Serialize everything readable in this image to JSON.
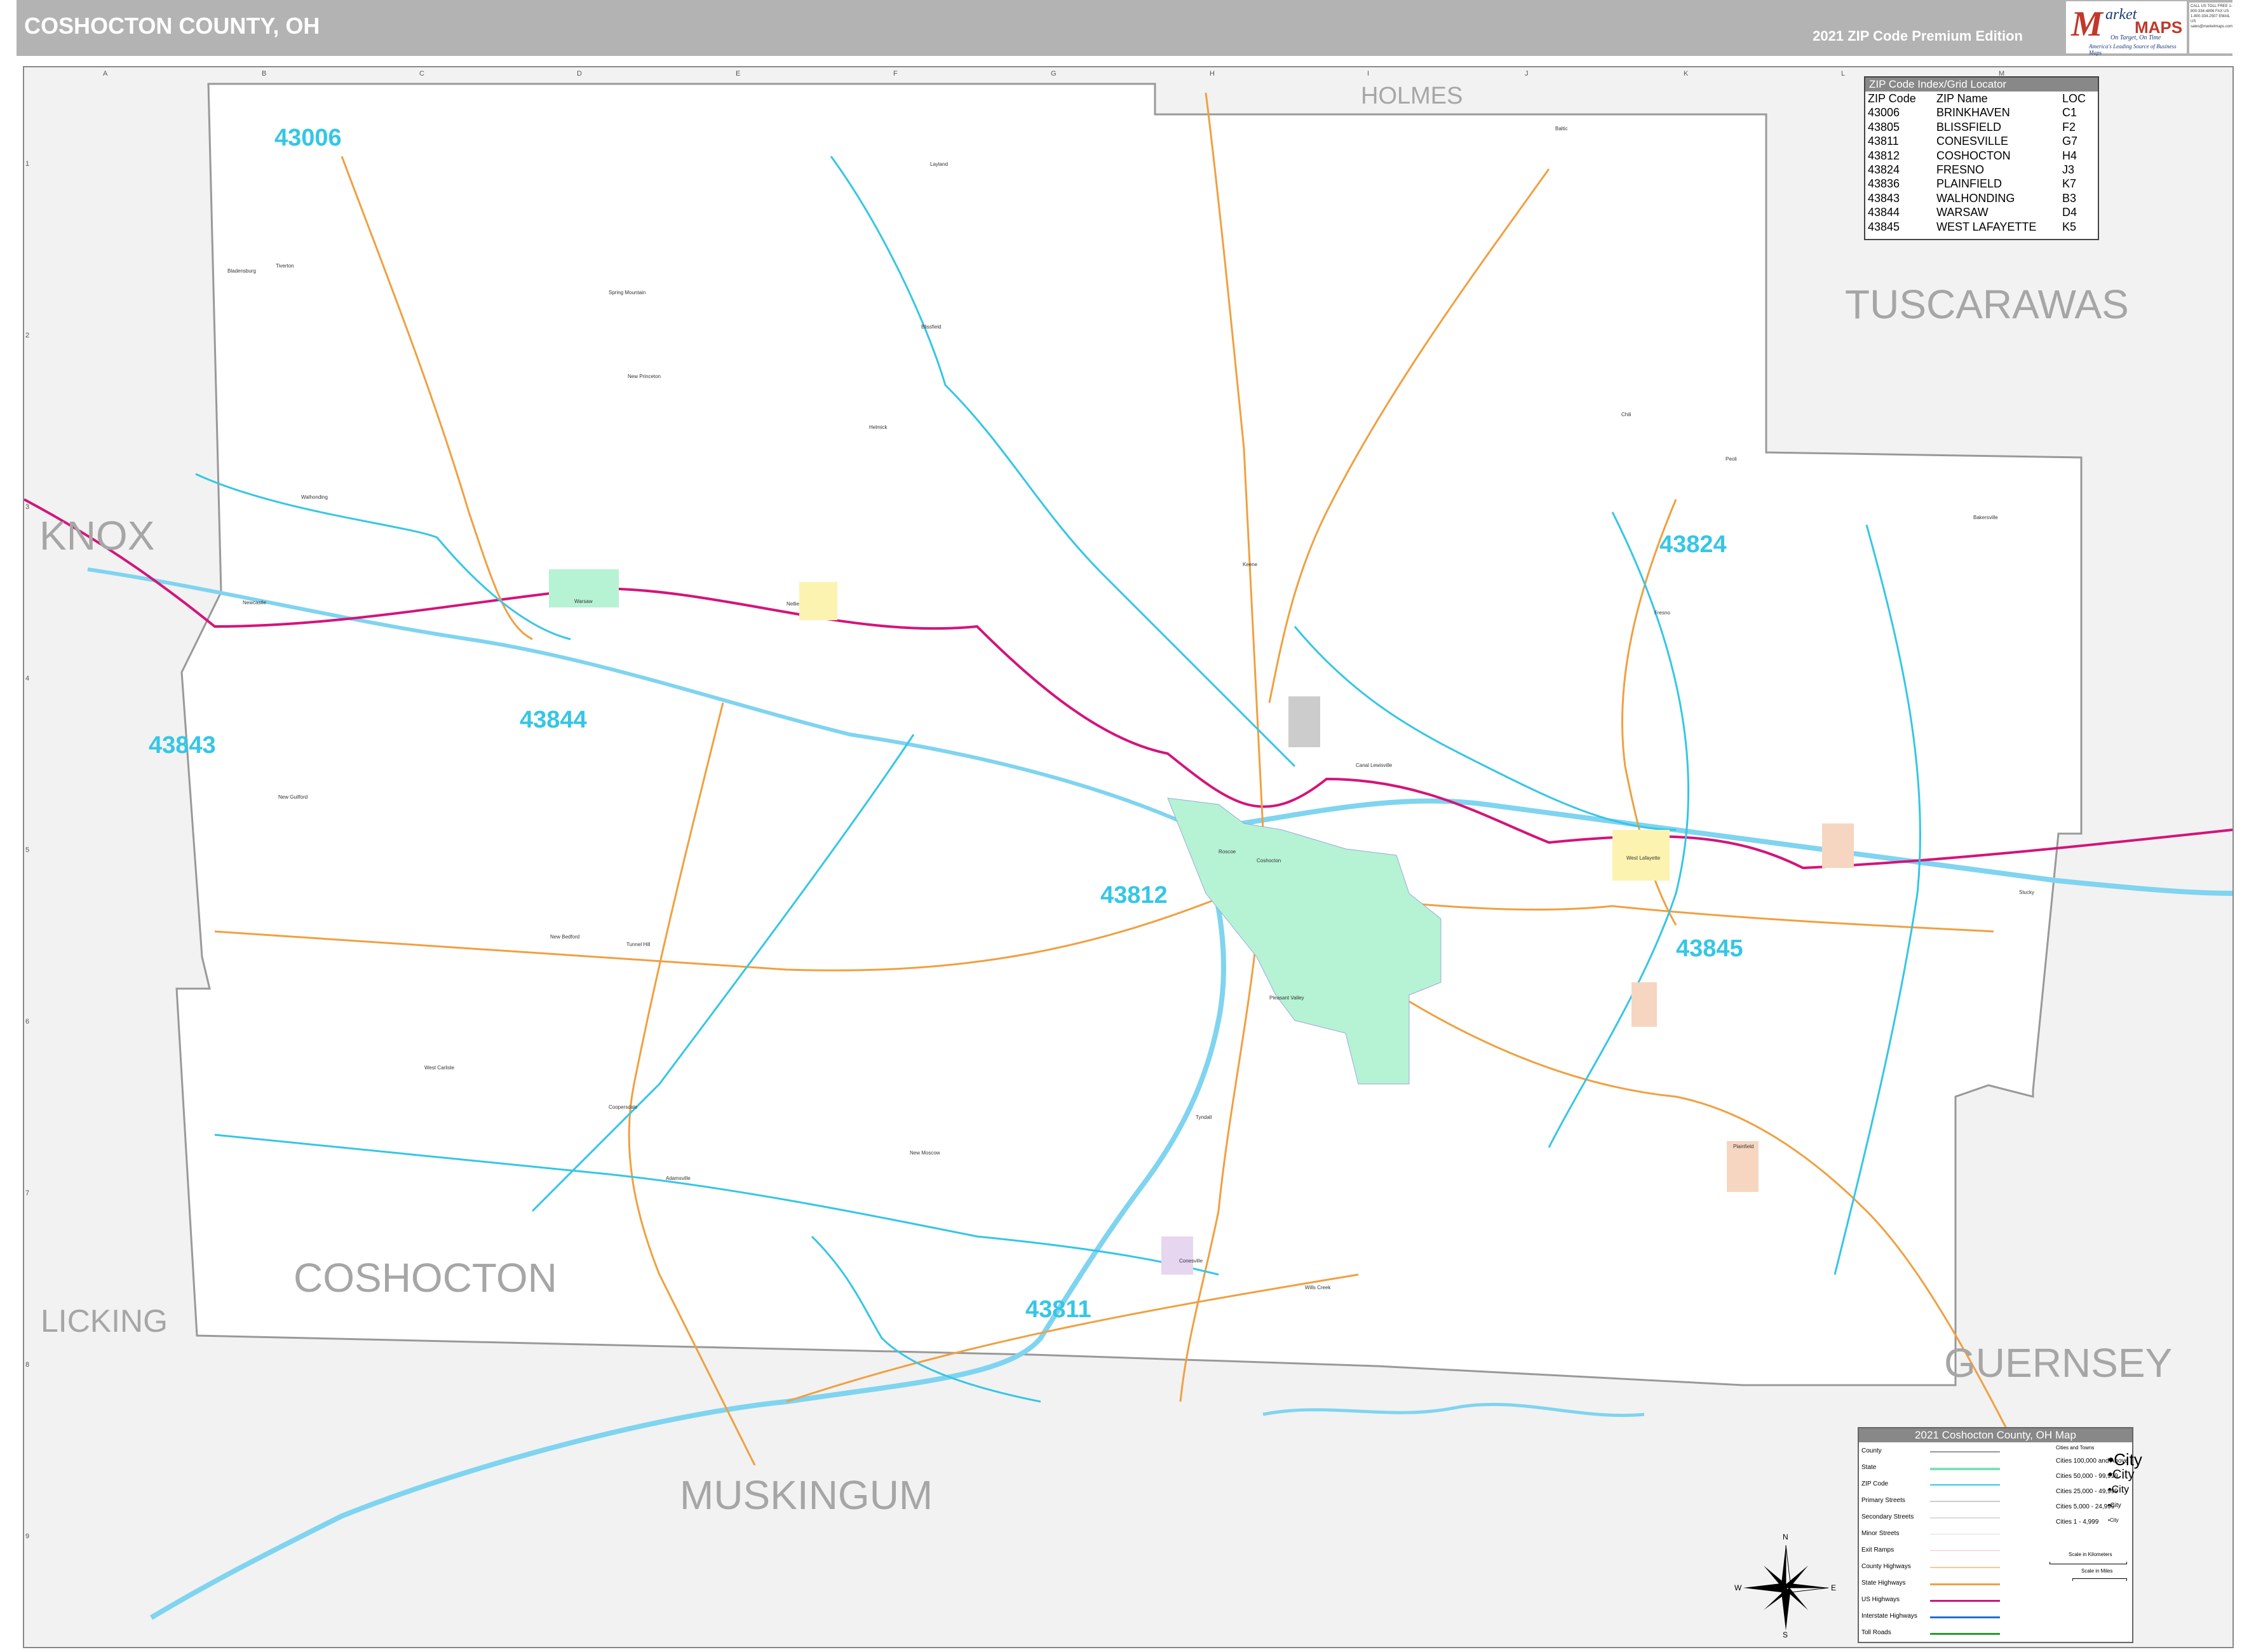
{
  "header": {
    "title": "COSHOCTON COUNTY, OH",
    "edition": "2021 ZIP Code Premium Edition"
  },
  "logo": {
    "m": "M",
    "arket": "arket",
    "maps": "MAPS",
    "tagline1": "On Target, On Time",
    "tagline2": "America's Leading Source of Business Maps",
    "contact": "CALL US TOLL FREE 1-800-334-4806 FAX US 1-800-334-2507 EMAIL US sales@marketmaps.com"
  },
  "counties": {
    "holmes": "HOLMES",
    "tuscarawas": "TUSCARAWAS",
    "knox": "KNOX",
    "coshocton": "COSHOCTON",
    "licking": "LICKING",
    "guernsey": "GUERNSEY",
    "muskingum": "MUSKINGUM"
  },
  "zip_labels": [
    "43006",
    "43824",
    "43843",
    "43844",
    "43812",
    "43845",
    "43811"
  ],
  "places": {
    "walhonding": "Walhonding",
    "newcastle": "Newcastle",
    "warsaw": "Warsaw",
    "nellie": "Nellie",
    "fresno": "Fresno",
    "coshocton": "Coshocton",
    "canal_lewisville": "Canal Lewisville",
    "west_lafayette": "West Lafayette",
    "conesville": "Conesville",
    "plainfield": "Plainfield",
    "new_bedford": "New Bedford",
    "spring_mountain": "Spring Mountain",
    "new_guilford": "New Guilford",
    "bakersville": "Bakersville",
    "blissfield": "Blissfield",
    "tunnel_hill": "Tunnel Hill",
    "west_carlisle": "West Carlisle",
    "keene": "Keene",
    "roscoe": "Roscoe",
    "pleasant_valley": "Pleasant Valley",
    "isleta": "Isleta",
    "new_moscow": "New Moscow",
    "wills_creek": "Wills Creek",
    "coopersdale": "Coopersdale",
    "adamsville": "Adamsville",
    "mohawk_village": "Mohawk Village",
    "helmick": "Helmick",
    "wolfcreek": "Wolf Creek",
    "chili": "Chili",
    "peoli": "Peoli",
    "layland": "Layland",
    "new_princeton": "New Princeton",
    "tyndall": "Tyndall",
    "stucky": "Stucky",
    "orange": "Orange",
    "tiverton": "Tiverton",
    "bladensburg": "Bladensburg",
    "baltic": "Baltic"
  },
  "grid": {
    "cols": [
      "A",
      "B",
      "C",
      "D",
      "E",
      "F",
      "G",
      "H",
      "I",
      "J",
      "K",
      "L",
      "M"
    ],
    "rows": [
      "1",
      "2",
      "3",
      "4",
      "5",
      "6",
      "7",
      "8",
      "9"
    ]
  },
  "zip_index": {
    "header": "ZIP Code Index/Grid Locator",
    "columns": [
      "ZIP Code",
      "ZIP Name",
      "LOC"
    ],
    "rows": [
      [
        "43006",
        "BRINKHAVEN",
        "C1"
      ],
      [
        "43805",
        "BLISSFIELD",
        "F2"
      ],
      [
        "43811",
        "CONESVILLE",
        "G7"
      ],
      [
        "43812",
        "COSHOCTON",
        "H4"
      ],
      [
        "43824",
        "FRESNO",
        "J3"
      ],
      [
        "43836",
        "PLAINFIELD",
        "K7"
      ],
      [
        "43843",
        "WALHONDING",
        "B3"
      ],
      [
        "43844",
        "WARSAW",
        "D4"
      ],
      [
        "43845",
        "WEST LAFAYETTE",
        "K5"
      ]
    ]
  },
  "legend": {
    "header": "2021 Coshocton County, OH Map",
    "rows": [
      "County",
      "State",
      "ZIP Code",
      "Primary Streets",
      "Secondary Streets",
      "Minor Streets",
      "Exit Ramps",
      "County Highways",
      "State Highways",
      "US Highways",
      "Interstate Highways",
      "Toll Roads"
    ],
    "cities_header": "Cities and Towns",
    "cities": [
      "Cities 100,000 and Above",
      "Cities 50,000 - 99,999",
      "Cities 25,000 - 49,999",
      "Cities 5,000 - 24,999",
      "Cities 1 - 4,999"
    ],
    "city_samples": [
      "City",
      "City",
      "City",
      "City",
      "City"
    ],
    "scale_km": "Scale in Kilometers",
    "scale_mi": "Scale in Miles"
  },
  "compass": {
    "n": "N",
    "s": "S",
    "e": "E",
    "w": "W"
  },
  "colors": {
    "county_fill": "#ffffff",
    "outside_fill": "#f2f2f2",
    "zip_line": "#35c6e6",
    "us_highway": "#d4147a",
    "state_highway": "#f0a040",
    "water": "#7fd4f0",
    "city_green": "#b6f2d4"
  }
}
